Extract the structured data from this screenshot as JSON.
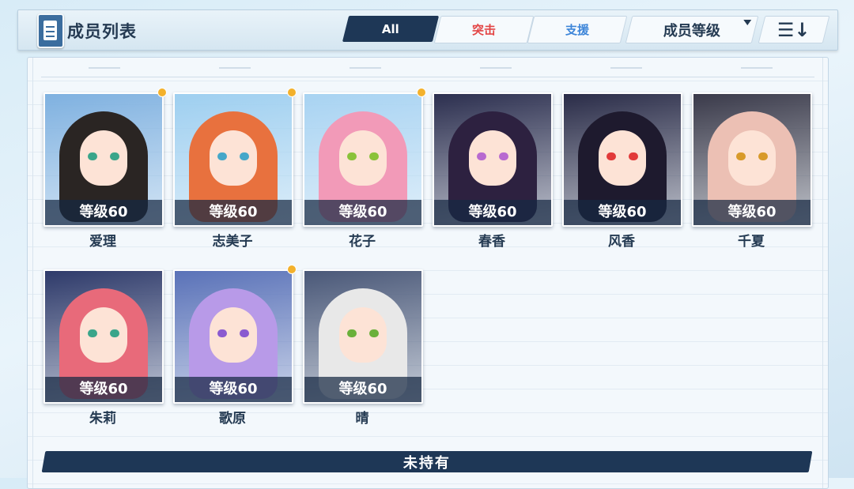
{
  "header": {
    "title": "成员列表",
    "tabs": {
      "all": "All",
      "assault": "突击",
      "support": "支援"
    },
    "sort_label": "成员等级",
    "order_icon": "☰↓"
  },
  "section_footer": "未持有",
  "members": [
    {
      "name": "爱理",
      "level": "等级60",
      "new": true,
      "bg": "#7fb1e0",
      "hair": "#2a2523",
      "eye": "#3aa58a"
    },
    {
      "name": "志美子",
      "level": "等级60",
      "new": true,
      "bg": "#9ecff0",
      "hair": "#e8713e",
      "eye": "#45a7c9"
    },
    {
      "name": "花子",
      "level": "等级60",
      "new": true,
      "bg": "#a8d3f2",
      "hair": "#f29ab8",
      "eye": "#8ac23a"
    },
    {
      "name": "春香",
      "level": "等级60",
      "new": false,
      "bg": "#2c2f4f",
      "hair": "#2d2140",
      "eye": "#b86ad0"
    },
    {
      "name": "风香",
      "level": "等级60",
      "new": false,
      "bg": "#2a2c48",
      "hair": "#1e1a2e",
      "eye": "#e23a3a"
    },
    {
      "name": "千夏",
      "level": "等级60",
      "new": false,
      "bg": "#3a3a4a",
      "hair": "#ecc0b4",
      "eye": "#d89a2a"
    },
    {
      "name": "朱莉",
      "level": "等级60",
      "new": false,
      "bg": "#2e3a6a",
      "hair": "#e86a7a",
      "eye": "#3aa58a"
    },
    {
      "name": "歌原",
      "level": "等级60",
      "new": true,
      "bg": "#5a72b8",
      "hair": "#b89ae8",
      "eye": "#8a5ad0"
    },
    {
      "name": "晴",
      "level": "等级60",
      "new": false,
      "bg": "#4a5878",
      "hair": "#e8e8e8",
      "eye": "#6ab03a"
    }
  ],
  "colors": {
    "accent": "#1e3756",
    "new_dot": "#f3b12c",
    "assault": "#e34646",
    "support": "#3e86d9"
  }
}
